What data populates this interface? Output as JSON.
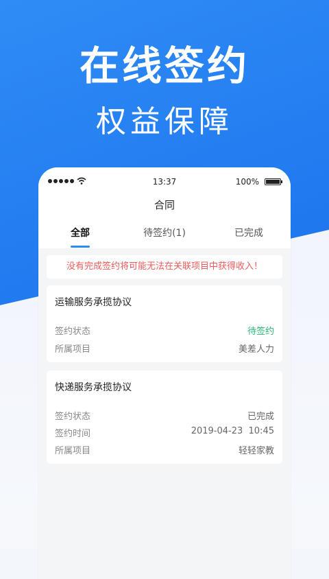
{
  "hero": {
    "title": "在线签约",
    "subtitle": "权益保障"
  },
  "status_bar": {
    "time": "13:37",
    "battery": "100%"
  },
  "nav": {
    "title": "合同"
  },
  "tabs": [
    {
      "label": "全部",
      "active": true
    },
    {
      "label": "待签约(1)",
      "active": false
    },
    {
      "label": "已完成",
      "active": false
    }
  ],
  "notice": "没有完成签约将可能无法在关联项目中获得收入！",
  "contracts": [
    {
      "title": "运输服务承揽协议",
      "status_label": "签约状态",
      "status_value": "待签约",
      "project_label": "所属项目",
      "project_value": "美差人力"
    },
    {
      "title": "快递服务承揽协议",
      "status_label": "签约状态",
      "status_value": "已完成",
      "time_label": "签约时间",
      "time_value": "2019-04-23  10:45",
      "project_label": "所属项目",
      "project_value": "轻轻家教"
    }
  ],
  "colors": {
    "accent": "#2f8cf5",
    "pending": "#2bb673",
    "warning": "#ee5a5a"
  }
}
